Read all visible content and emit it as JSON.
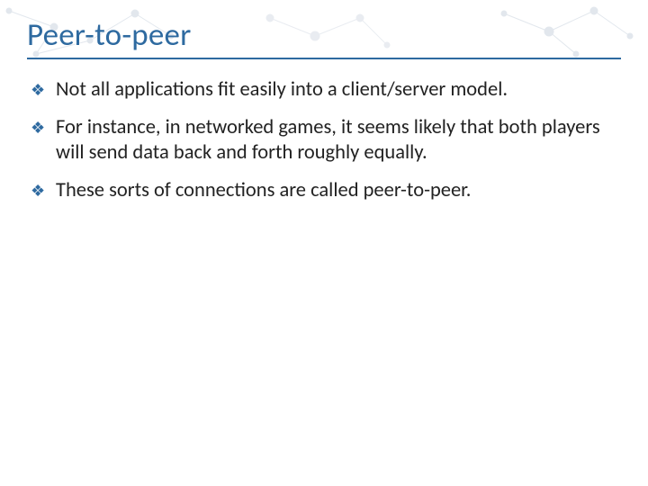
{
  "title": "Peer-to-peer",
  "bullets": [
    {
      "text": "Not all applications fit easily into a client/server model."
    },
    {
      "text": "For instance, in networked games, it seems likely that both players will send data back and forth roughly equally."
    },
    {
      "text": "These sorts of connections are called peer-to-peer."
    }
  ],
  "accent_color": "#2e6aa0"
}
